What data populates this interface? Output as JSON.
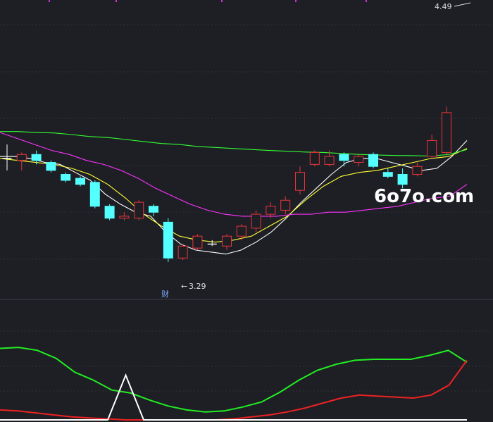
{
  "watermark": "6o7o.com",
  "annotations": {
    "high_label": "4.49",
    "low_label": "3.29",
    "event_marker": "财"
  },
  "colors": {
    "background": "#1e1f25",
    "up": "#e8343b",
    "down": "#54ffff",
    "ma5": "#ffffff",
    "ma10": "#ffff33",
    "ma20": "#ff33ff",
    "ma60": "#33ff33",
    "osc_green": "#22ee22",
    "osc_red": "#ee2222",
    "spike": "#ffffff",
    "grid": "#2d3038",
    "top_marks": "#cc33cc"
  },
  "chart_data": [
    {
      "type": "candlestick",
      "title": "",
      "ylim": [
        3.1,
        4.55
      ],
      "candles": [
        {
          "o": 3.79,
          "h": 3.86,
          "l": 3.73,
          "c": 3.79
        },
        {
          "o": 3.78,
          "h": 3.82,
          "l": 3.73,
          "c": 3.81
        },
        {
          "o": 3.81,
          "h": 3.83,
          "l": 3.76,
          "c": 3.78
        },
        {
          "o": 3.77,
          "h": 3.78,
          "l": 3.72,
          "c": 3.73
        },
        {
          "o": 3.71,
          "h": 3.72,
          "l": 3.67,
          "c": 3.68
        },
        {
          "o": 3.69,
          "h": 3.7,
          "l": 3.65,
          "c": 3.66
        },
        {
          "o": 3.67,
          "h": 3.68,
          "l": 3.54,
          "c": 3.55
        },
        {
          "o": 3.55,
          "h": 3.56,
          "l": 3.48,
          "c": 3.49
        },
        {
          "o": 3.49,
          "h": 3.52,
          "l": 3.48,
          "c": 3.5
        },
        {
          "o": 3.49,
          "h": 3.58,
          "l": 3.48,
          "c": 3.57
        },
        {
          "o": 3.55,
          "h": 3.56,
          "l": 3.5,
          "c": 3.52
        },
        {
          "o": 3.47,
          "h": 3.49,
          "l": 3.27,
          "c": 3.29
        },
        {
          "o": 3.29,
          "h": 3.36,
          "l": 3.28,
          "c": 3.35
        },
        {
          "o": 3.34,
          "h": 3.41,
          "l": 3.33,
          "c": 3.4
        },
        {
          "o": 3.36,
          "h": 3.38,
          "l": 3.35,
          "c": 3.36
        },
        {
          "o": 3.35,
          "h": 3.41,
          "l": 3.33,
          "c": 3.4
        },
        {
          "o": 3.4,
          "h": 3.46,
          "l": 3.38,
          "c": 3.45
        },
        {
          "o": 3.44,
          "h": 3.53,
          "l": 3.42,
          "c": 3.51
        },
        {
          "o": 3.51,
          "h": 3.57,
          "l": 3.49,
          "c": 3.55
        },
        {
          "o": 3.53,
          "h": 3.6,
          "l": 3.51,
          "c": 3.58
        },
        {
          "o": 3.63,
          "h": 3.75,
          "l": 3.61,
          "c": 3.72
        },
        {
          "o": 3.76,
          "h": 3.83,
          "l": 3.75,
          "c": 3.82
        },
        {
          "o": 3.76,
          "h": 3.83,
          "l": 3.75,
          "c": 3.8
        },
        {
          "o": 3.81,
          "h": 3.82,
          "l": 3.75,
          "c": 3.78
        },
        {
          "o": 3.77,
          "h": 3.81,
          "l": 3.75,
          "c": 3.8
        },
        {
          "o": 3.81,
          "h": 3.82,
          "l": 3.74,
          "c": 3.75
        },
        {
          "o": 3.72,
          "h": 3.74,
          "l": 3.69,
          "c": 3.7
        },
        {
          "o": 3.71,
          "h": 3.74,
          "l": 3.64,
          "c": 3.66
        },
        {
          "o": 3.71,
          "h": 3.77,
          "l": 3.7,
          "c": 3.75
        },
        {
          "o": 3.8,
          "h": 3.91,
          "l": 3.79,
          "c": 3.88
        },
        {
          "o": 3.82,
          "h": 4.05,
          "l": 3.81,
          "c": 4.02
        }
      ],
      "ma_lines": [
        {
          "period": "MA5",
          "values": [
            3.8,
            3.8,
            3.79,
            3.77,
            3.76,
            3.72,
            3.68,
            3.61,
            3.56,
            3.52,
            3.5,
            3.42,
            3.36,
            3.33,
            3.32,
            3.31,
            3.33,
            3.37,
            3.42,
            3.49,
            3.57,
            3.64,
            3.71,
            3.77,
            3.79,
            3.79,
            3.77,
            3.75,
            3.73,
            3.74,
            3.8,
            3.88
          ]
        },
        {
          "period": "MA10",
          "values": [
            3.79,
            3.78,
            3.77,
            3.76,
            3.74,
            3.71,
            3.66,
            3.59,
            3.51,
            3.45,
            3.4,
            3.38,
            3.37,
            3.38,
            3.4,
            3.45,
            3.5,
            3.58,
            3.65,
            3.7,
            3.72,
            3.73,
            3.75,
            3.77,
            3.79,
            3.8,
            3.84
          ]
        },
        {
          "period": "MA20",
          "values": [
            3.92,
            3.89,
            3.86,
            3.83,
            3.81,
            3.78,
            3.76,
            3.73,
            3.69,
            3.64,
            3.6,
            3.56,
            3.53,
            3.51,
            3.5,
            3.5,
            3.5,
            3.51,
            3.51,
            3.52,
            3.52,
            3.53,
            3.54,
            3.55,
            3.57,
            3.59,
            3.6,
            3.66
          ]
        },
        {
          "period": "MA60",
          "values": [
            3.925,
            3.925,
            3.92,
            3.918,
            3.91,
            3.9,
            3.895,
            3.885,
            3.875,
            3.865,
            3.86,
            3.85,
            3.845,
            3.84,
            3.835,
            3.83,
            3.826,
            3.822,
            3.82,
            3.815,
            3.81,
            3.807,
            3.805,
            3.804,
            3.802,
            3.81,
            3.835
          ]
        }
      ]
    },
    {
      "type": "line",
      "title": "",
      "ylim": [
        0,
        100
      ],
      "series": [
        {
          "values": [
            72,
            73,
            70,
            62,
            48,
            40,
            30,
            27,
            20,
            14,
            10,
            8,
            9,
            13,
            18,
            28,
            40,
            50,
            56,
            60,
            61,
            61,
            61,
            65,
            70,
            58
          ]
        },
        {
          "values": [
            10,
            9,
            7,
            5,
            3,
            2,
            1,
            0,
            0,
            0,
            0,
            0,
            0,
            1,
            3,
            5,
            8,
            12,
            17,
            22,
            25,
            24,
            23,
            22,
            25,
            35,
            60
          ]
        },
        {
          "values": [
            0,
            0,
            0,
            0,
            0,
            0,
            0,
            45,
            0,
            0,
            0,
            0,
            0,
            0,
            0,
            0,
            0,
            0,
            0,
            0,
            0,
            0,
            0,
            0,
            0,
            0,
            0
          ]
        }
      ]
    }
  ]
}
